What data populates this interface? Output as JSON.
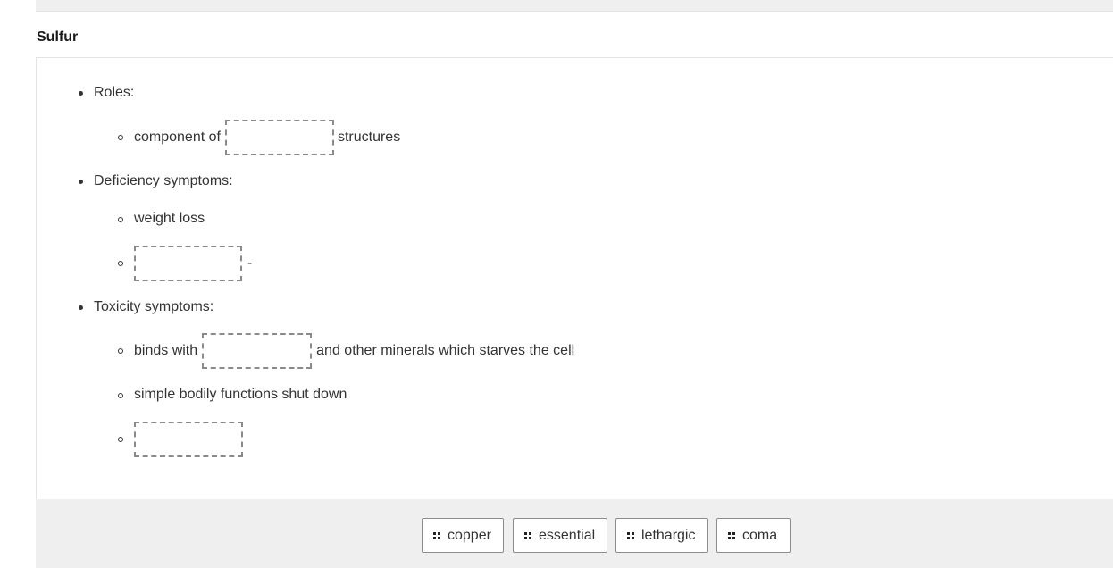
{
  "section": {
    "title": "Sulfur"
  },
  "roles": {
    "label": "Roles:",
    "item1": {
      "before": "component of",
      "after": "structures"
    }
  },
  "deficiency": {
    "label": "Deficiency symptoms:",
    "item1": "weight loss",
    "item2": {
      "after": "-"
    }
  },
  "toxicity": {
    "label": "Toxicity symptoms:",
    "item1": {
      "before": "binds with",
      "after": "and other minerals which starves the cell"
    },
    "item2": "simple bodily functions shut down"
  },
  "tokens": [
    {
      "label": "copper"
    },
    {
      "label": "essential"
    },
    {
      "label": "lethargic"
    },
    {
      "label": "coma"
    }
  ],
  "icons": {
    "drag_handle": "drag-handle-icon"
  },
  "colors": {
    "tray_background": "#efefef",
    "drop_zone_border": "#8a8a8a",
    "text": "#333333"
  }
}
